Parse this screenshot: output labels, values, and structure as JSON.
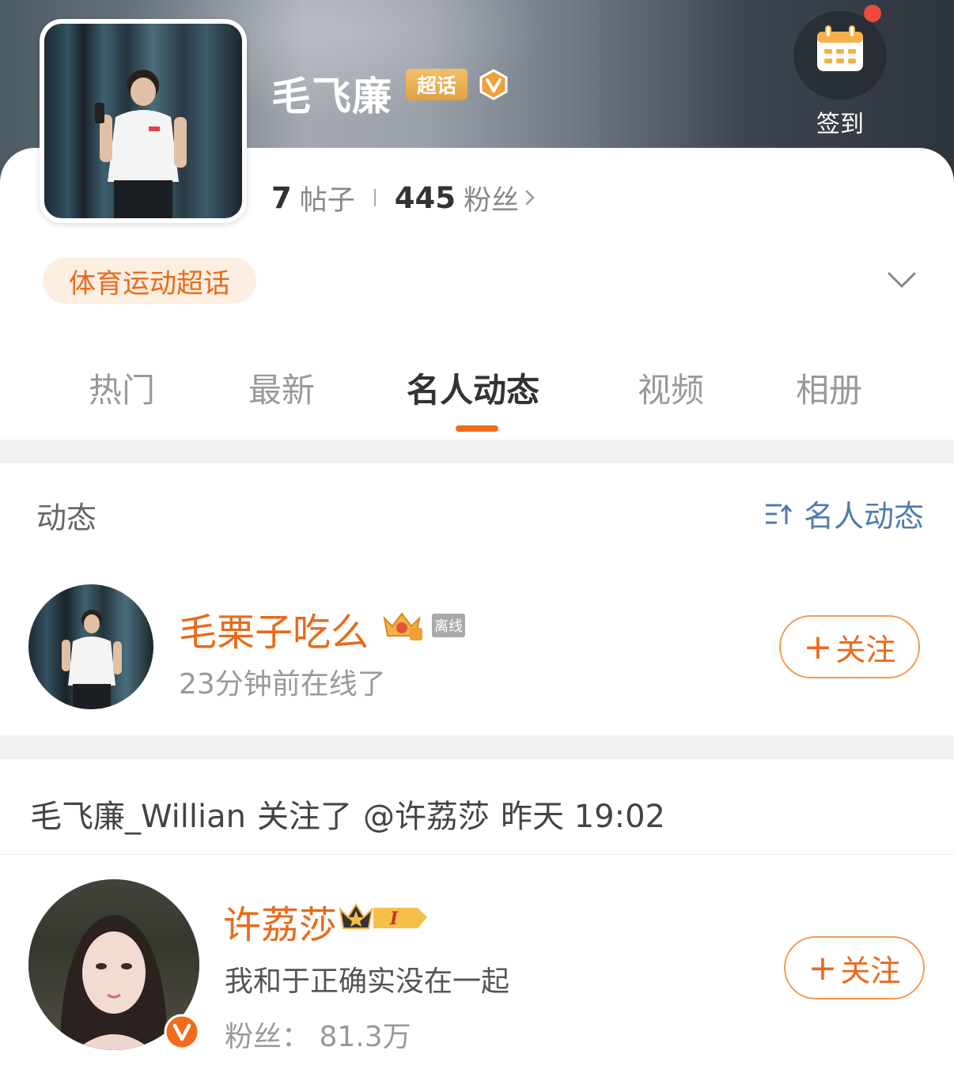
{
  "header": {
    "topic_name": "毛飞廉",
    "super_badge": "超话",
    "checkin_label": "签到",
    "stats": {
      "posts_count": "7",
      "posts_label": "帖子",
      "fans_count": "445",
      "fans_label": "粉丝"
    },
    "category_tag": "体育运动超话"
  },
  "tabs": [
    "热门",
    "最新",
    "名人动态",
    "视频",
    "相册"
  ],
  "active_tab": "名人动态",
  "section": {
    "title": "动态",
    "filter_label": "名人动态"
  },
  "user_card_1": {
    "name": "毛栗子吃么",
    "offline_tag": "离线",
    "status": "23分钟前在线了",
    "follow_label": "关注"
  },
  "activity": {
    "actor": "毛飞廉_Willian",
    "action": "关注了",
    "target": "@许荔莎",
    "time": "昨天 19:02"
  },
  "user_card_2": {
    "name": "许荔莎",
    "description": "我和于正确实没在一起",
    "fans": "粉丝： 81.3万",
    "follow_label": "关注"
  },
  "colors": {
    "accent_orange": "#ea6a1b",
    "tab_indicator": "#f36a1d",
    "filter_blue": "#507cae",
    "badge_gold": "#e3a040"
  }
}
